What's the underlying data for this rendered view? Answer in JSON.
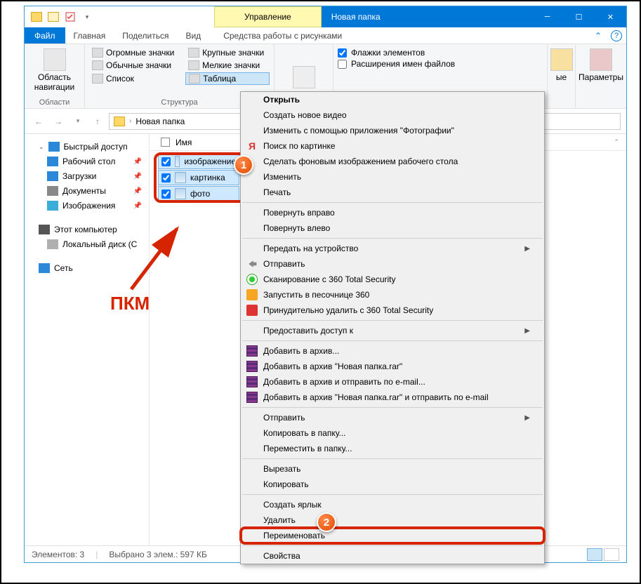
{
  "titlebar": {
    "manage_tab": "Управление",
    "title": "Новая папка"
  },
  "ribbon_tabs": {
    "file": "Файл",
    "home": "Главная",
    "share": "Поделиться",
    "view": "Вид",
    "contextual": "Средства работы с рисунками"
  },
  "ribbon": {
    "nav_area": "Область навигации",
    "group_areas": "Области",
    "huge_icons": "Огромные значки",
    "large_icons": "Крупные значки",
    "normal_icons": "Обычные значки",
    "small_icons": "Мелкие значки",
    "list": "Список",
    "table": "Таблица",
    "group_layout": "Структура",
    "item_checkboxes": "Флажки элементов",
    "file_ext": "Расширения имен файлов",
    "hidden_suffix": "ые",
    "params": "Параметры"
  },
  "address": {
    "path": "Новая папка"
  },
  "nav": {
    "quick": "Быстрый доступ",
    "desktop": "Рабочий стол",
    "downloads": "Загрузки",
    "documents": "Документы",
    "pictures": "Изображения",
    "thispc": "Этот компьютер",
    "localdisk": "Локальный диск (C",
    "network": "Сеть"
  },
  "columns": {
    "name": "Имя"
  },
  "files": [
    {
      "name": "изображение"
    },
    {
      "name": "картинка"
    },
    {
      "name": "фото"
    }
  ],
  "context_menu": {
    "open": "Открыть",
    "new_video": "Создать новое видео",
    "edit_photos": "Изменить с помощью приложения \"Фотографии\"",
    "search_img": "Поиск по картинке",
    "set_wallpaper": "Сделать фоновым изображением рабочего стола",
    "edit": "Изменить",
    "print": "Печать",
    "rotate_right": "Повернуть вправо",
    "rotate_left": "Повернуть влево",
    "cast": "Передать на устройство",
    "share": "Отправить",
    "scan_360": "Сканирование с 360 Total Security",
    "sandbox_360": "Запустить в песочнице 360",
    "force_delete_360": "Принудительно удалить с  360 Total Security",
    "grant_access": "Предоставить доступ к",
    "add_archive": "Добавить в архив...",
    "add_archive_rar": "Добавить в архив \"Новая папка.rar\"",
    "add_send_email": "Добавить в архив и отправить по e-mail...",
    "add_rar_send": "Добавить в архив \"Новая папка.rar\" и отправить по e-mail",
    "send_to": "Отправить",
    "copy_to": "Копировать в папку...",
    "move_to": "Переместить в папку...",
    "cut": "Вырезать",
    "copy": "Копировать",
    "shortcut": "Создать ярлык",
    "delete": "Удалить",
    "rename": "Переименовать",
    "properties": "Свойства"
  },
  "status": {
    "elements": "Элементов: 3",
    "selected": "Выбрано 3 элем.: 597 КБ"
  },
  "annotations": {
    "badge1": "1",
    "badge2": "2",
    "pkm": "ПКМ"
  }
}
